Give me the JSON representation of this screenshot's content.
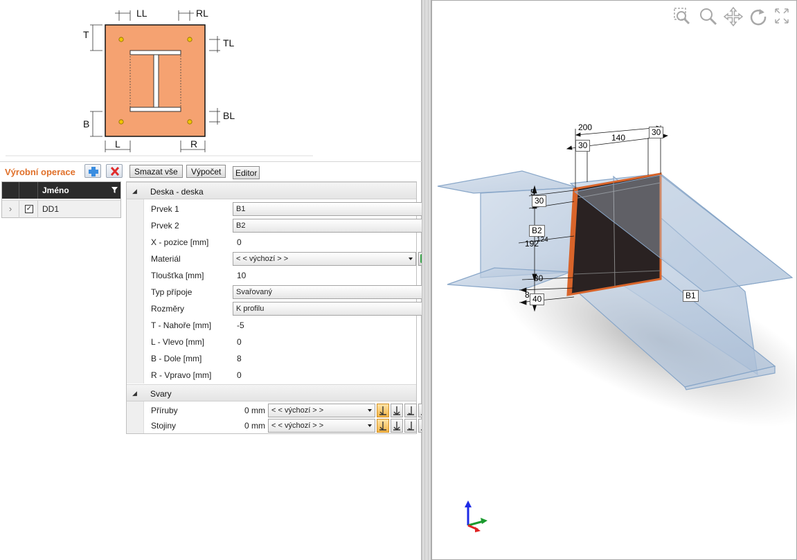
{
  "schematic": {
    "labels": {
      "ll": "LL",
      "rl": "RL",
      "t": "T",
      "tl": "TL",
      "b": "B",
      "bl": "BL",
      "l": "L",
      "r": "R"
    },
    "plate_color": "#f5a271",
    "bolt_color": "#f2c400"
  },
  "operations": {
    "title": "Výrobní operace",
    "buttons": {
      "add": "add-icon",
      "delete": "delete-icon",
      "delete_all": "Smazat vše",
      "calculate": "Výpočet",
      "editor": "Editor"
    },
    "title_color": "#e0702a"
  },
  "list": {
    "column_name": "Jméno",
    "rows": [
      {
        "expander": "›",
        "checked": true,
        "name": "DD1"
      }
    ]
  },
  "properties": {
    "section1": {
      "title": "Deska - deska",
      "rows": {
        "prvek1": {
          "label": "Prvek 1",
          "value": "B1"
        },
        "prvek2": {
          "label": "Prvek 2",
          "value": "B2"
        },
        "xpos": {
          "label": "X - pozice [mm]",
          "value": "0"
        },
        "material": {
          "label": "Materiál",
          "value": "< < výchozí > >"
        },
        "tloustka": {
          "label": "Tloušťka [mm]",
          "value": "10"
        },
        "typ": {
          "label": "Typ přípoje",
          "value": "Svařovaný"
        },
        "rozmery": {
          "label": "Rozměry",
          "value": "K profilu"
        },
        "t": {
          "label": "T - Nahoře [mm]",
          "value": "-5"
        },
        "l": {
          "label": "L - Vlevo [mm]",
          "value": "0"
        },
        "b": {
          "label": "B - Dole [mm]",
          "value": "8"
        },
        "r": {
          "label": "R - Vpravo [mm]",
          "value": "0"
        }
      }
    },
    "section2": {
      "title": "Svary",
      "rows": {
        "flanges": {
          "label": "Příruby",
          "size": "0 mm",
          "value": "< < výchozí > >"
        },
        "webs": {
          "label": "Stojiny",
          "size": "0 mm",
          "value": "< < výchozí > >"
        }
      }
    }
  },
  "view3d": {
    "toolbar": [
      "zoom-window-icon",
      "zoom-icon",
      "pan-icon",
      "rotate-icon",
      "fit-icon"
    ],
    "dimensions": {
      "top_200": "200",
      "top_30_left": "30",
      "top_140": "140",
      "top_30_right": "30",
      "side_5": "5",
      "side_30_top": "30",
      "side_192": "192",
      "side_124": "124",
      "side_30_bottom": "30",
      "side_8": "8",
      "side_40": "40"
    },
    "member_labels": {
      "b1": "B1",
      "b2": "B2"
    },
    "plate_color": "#d8642a"
  }
}
